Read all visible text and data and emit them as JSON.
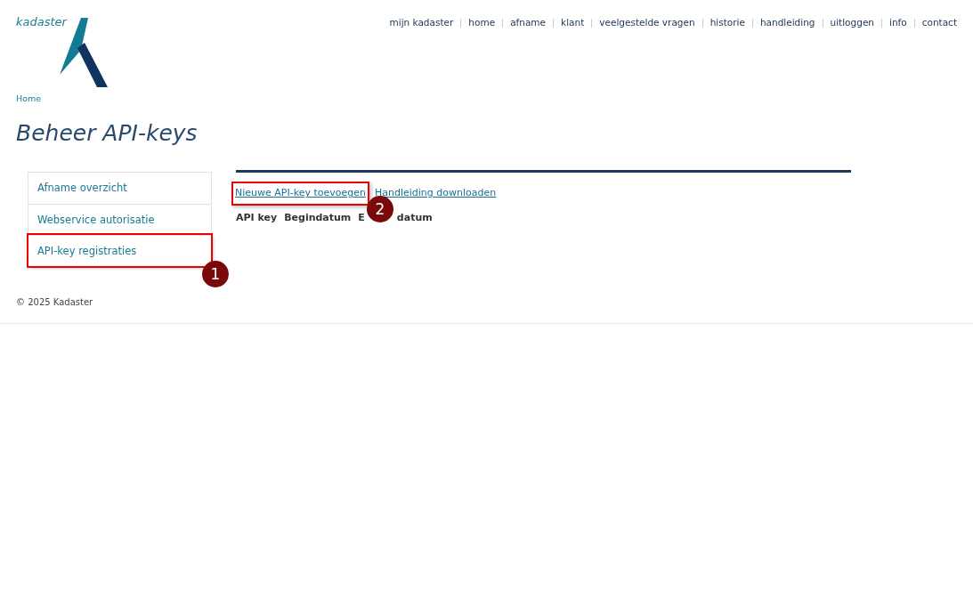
{
  "logo": {
    "text": "kadaster"
  },
  "nav": [
    "mijn kadaster",
    "home",
    "afname",
    "klant",
    "veelgestelde vragen",
    "historie",
    "handleiding",
    "uitloggen",
    "info",
    "contact"
  ],
  "breadcrumb": [
    "Home"
  ],
  "title": "Beheer API-keys",
  "sidebar": {
    "items": [
      {
        "label": "Afname overzicht"
      },
      {
        "label": "Webservice autorisatie"
      },
      {
        "label": "API-key registraties",
        "callout": "1"
      }
    ]
  },
  "actions": [
    {
      "label": "Nieuwe API-key toevoegen",
      "callout": "2"
    },
    {
      "label": "Handleiding downloaden"
    }
  ],
  "table": {
    "columns": [
      {
        "label": "API key"
      },
      {
        "label": "Begindatum"
      },
      {
        "label_start": "E",
        "label_end": "datum"
      }
    ]
  },
  "footer": "© 2025 Kadaster"
}
